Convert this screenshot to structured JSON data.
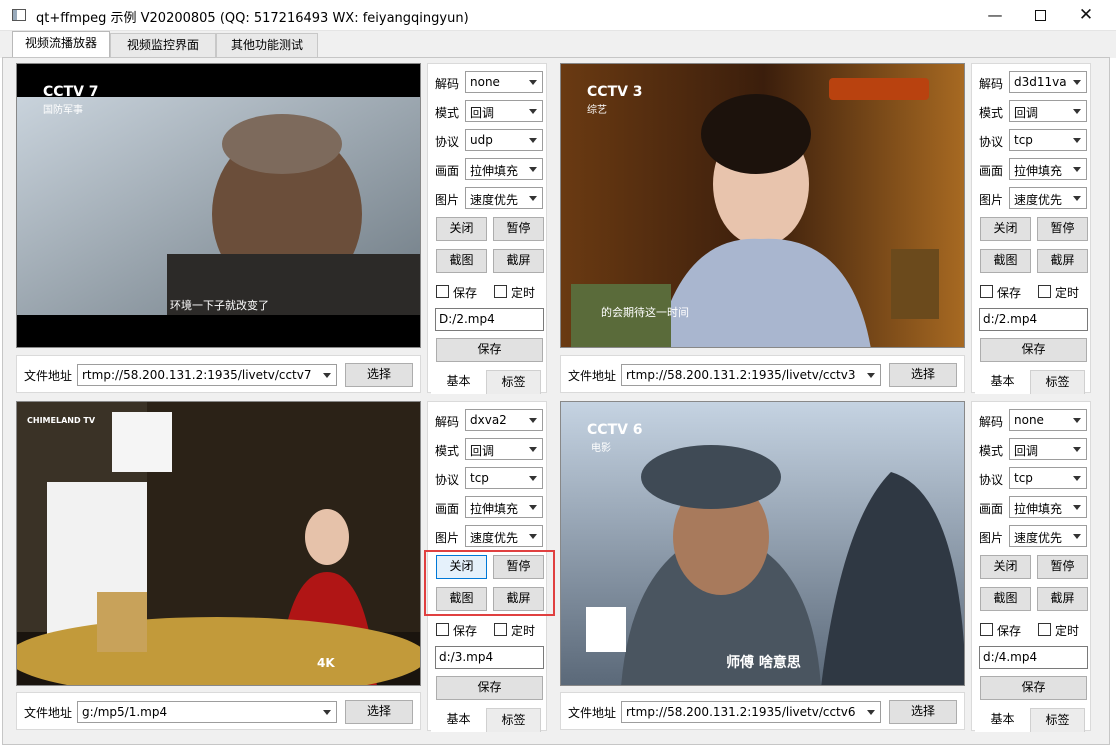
{
  "window": {
    "title": "qt+ffmpeg 示例 V20200805 (QQ: 517216493 WX: feiyangqingyun)",
    "minimize": "—",
    "close": "✕"
  },
  "tabs": [
    {
      "label": "视频流播放器"
    },
    {
      "label": "视频监控界面"
    },
    {
      "label": "其他功能测试"
    }
  ],
  "labels": {
    "decode": "解码",
    "mode": "模式",
    "protocol": "协议",
    "picture": "画面",
    "image": "图片",
    "close": "关闭",
    "pause": "暂停",
    "snapshot": "截图",
    "screen": "截屏",
    "save": "保存",
    "timer": "定时",
    "save_btn": "保存",
    "basic": "基本",
    "tags": "标签",
    "file_addr": "文件地址",
    "select": "选择"
  },
  "players": [
    {
      "overlay": "CCTV 7",
      "overlay_sub": "国防军事",
      "subtitle": "环境一下子就改变了",
      "url": "rtmp://58.200.131.2:1935/livetv/cctv7",
      "decode": "none",
      "mode": "回调",
      "protocol": "udp",
      "picture": "拉伸填充",
      "image": "速度优先",
      "path": "D:/2.mp4"
    },
    {
      "overlay": "CCTV 3",
      "overlay_sub": "综艺",
      "subtitle": "的会期待这一时间",
      "url": "rtmp://58.200.131.2:1935/livetv/cctv3",
      "decode": "d3d11va",
      "mode": "回调",
      "protocol": "tcp",
      "picture": "拉伸填充",
      "image": "速度优先",
      "path": "d:/2.mp4"
    },
    {
      "overlay": "CHIMELAND TV",
      "overlay_sub": "",
      "subtitle": "4K",
      "url": "g:/mp5/1.mp4",
      "decode": "dxva2",
      "mode": "回调",
      "protocol": "tcp",
      "picture": "拉伸填充",
      "image": "速度优先",
      "path": "d:/3.mp4"
    },
    {
      "overlay": "CCTV 6",
      "overlay_sub": "电影",
      "subtitle": "师傅  啥意思",
      "url": "rtmp://58.200.131.2:1935/livetv/cctv6",
      "decode": "none",
      "mode": "回调",
      "protocol": "tcp",
      "picture": "拉伸填充",
      "image": "速度优先",
      "path": "d:/4.mp4"
    }
  ]
}
